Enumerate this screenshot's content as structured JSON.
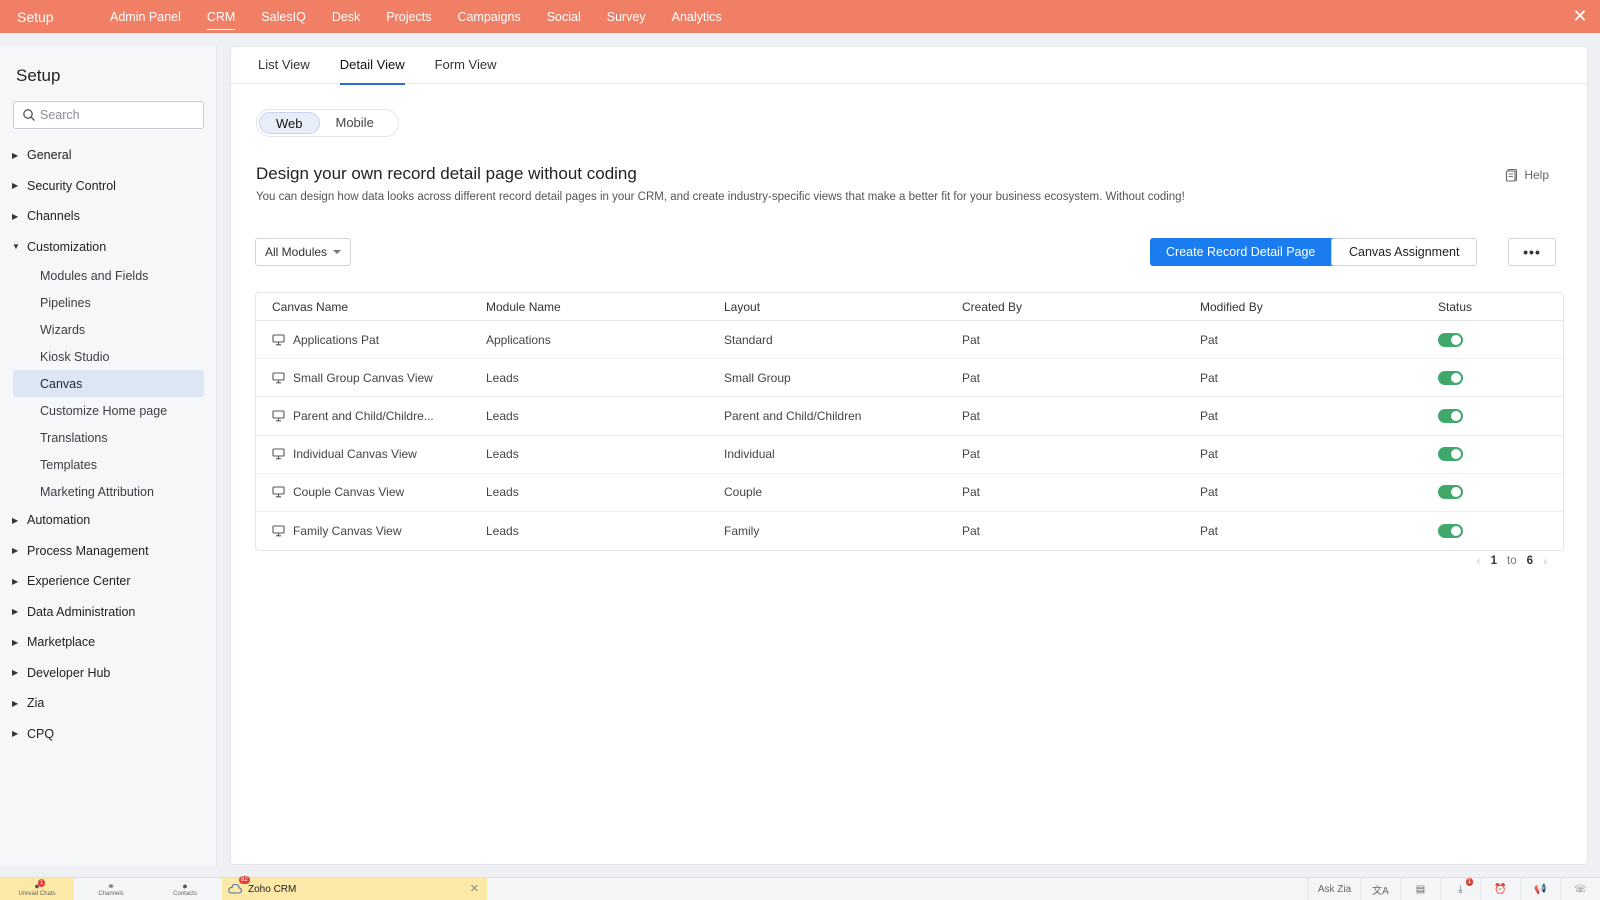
{
  "topbar": {
    "brand": "Setup",
    "nav": [
      "Admin Panel",
      "CRM",
      "SalesIQ",
      "Desk",
      "Projects",
      "Campaigns",
      "Social",
      "Survey",
      "Analytics"
    ],
    "active": "CRM",
    "close_icon": "close-icon"
  },
  "sidebar": {
    "title": "Setup",
    "search_placeholder": "Search",
    "groups": [
      {
        "label": "General",
        "expanded": false
      },
      {
        "label": "Security Control",
        "expanded": false
      },
      {
        "label": "Channels",
        "expanded": false
      },
      {
        "label": "Customization",
        "expanded": true
      },
      {
        "label": "Automation",
        "expanded": false
      },
      {
        "label": "Process Management",
        "expanded": false
      },
      {
        "label": "Experience Center",
        "expanded": false
      },
      {
        "label": "Data Administration",
        "expanded": false
      },
      {
        "label": "Marketplace",
        "expanded": false
      },
      {
        "label": "Developer Hub",
        "expanded": false
      },
      {
        "label": "Zia",
        "expanded": false
      },
      {
        "label": "CPQ",
        "expanded": false
      }
    ],
    "customization_items": [
      "Modules and Fields",
      "Pipelines",
      "Wizards",
      "Kiosk Studio",
      "Canvas",
      "Customize Home page",
      "Translations",
      "Templates",
      "Marketing Attribution"
    ],
    "active_item": "Canvas"
  },
  "tabs": [
    "List View",
    "Detail View",
    "Form View"
  ],
  "active_tab": "Detail View",
  "toggle": {
    "web": "Web",
    "mobile": "Mobile",
    "selected": "Web"
  },
  "heading": "Design your own record detail page without coding",
  "subtext": "You can design how data looks across different record detail pages in your CRM, and create industry-specific views that make a better fit for your business ecosystem. Without coding!",
  "help_label": "Help",
  "filter": {
    "selected": "All Modules"
  },
  "actions": {
    "create": "Create Record Detail Page",
    "assign": "Canvas Assignment",
    "more": "•••"
  },
  "table": {
    "columns": [
      "Canvas Name",
      "Module Name",
      "Layout",
      "Created By",
      "Modified By",
      "Status"
    ],
    "rows": [
      {
        "name": "Applications Pat",
        "module": "Applications",
        "layout": "Standard",
        "created": "Pat",
        "modified": "Pat",
        "status": true
      },
      {
        "name": "Small Group Canvas View",
        "module": "Leads",
        "layout": "Small Group",
        "created": "Pat",
        "modified": "Pat",
        "status": true
      },
      {
        "name": "Parent and Child/Childre...",
        "module": "Leads",
        "layout": "Parent and Child/Children",
        "created": "Pat",
        "modified": "Pat",
        "status": true
      },
      {
        "name": "Individual Canvas View",
        "module": "Leads",
        "layout": "Individual",
        "created": "Pat",
        "modified": "Pat",
        "status": true
      },
      {
        "name": "Couple Canvas View",
        "module": "Leads",
        "layout": "Couple",
        "created": "Pat",
        "modified": "Pat",
        "status": true
      },
      {
        "name": "Family Canvas View",
        "module": "Leads",
        "layout": "Family",
        "created": "Pat",
        "modified": "Pat",
        "status": true
      }
    ]
  },
  "pager": {
    "from": "1",
    "to_label": "to",
    "to": "6"
  },
  "bottombar": {
    "items": [
      {
        "label": "Unread Chats",
        "badge": "1"
      },
      {
        "label": "Channels"
      },
      {
        "label": "Contacts"
      }
    ],
    "app_tab": {
      "label": "Zoho CRM",
      "badge": "82"
    },
    "right": {
      "ask_zia": "Ask Zia",
      "notif_badge": "1"
    }
  },
  "colors": {
    "topbar": "#f07f65",
    "primary": "#1b7cf0",
    "switch_on": "#3fa86a",
    "active_item_bg": "#dde6f3"
  }
}
